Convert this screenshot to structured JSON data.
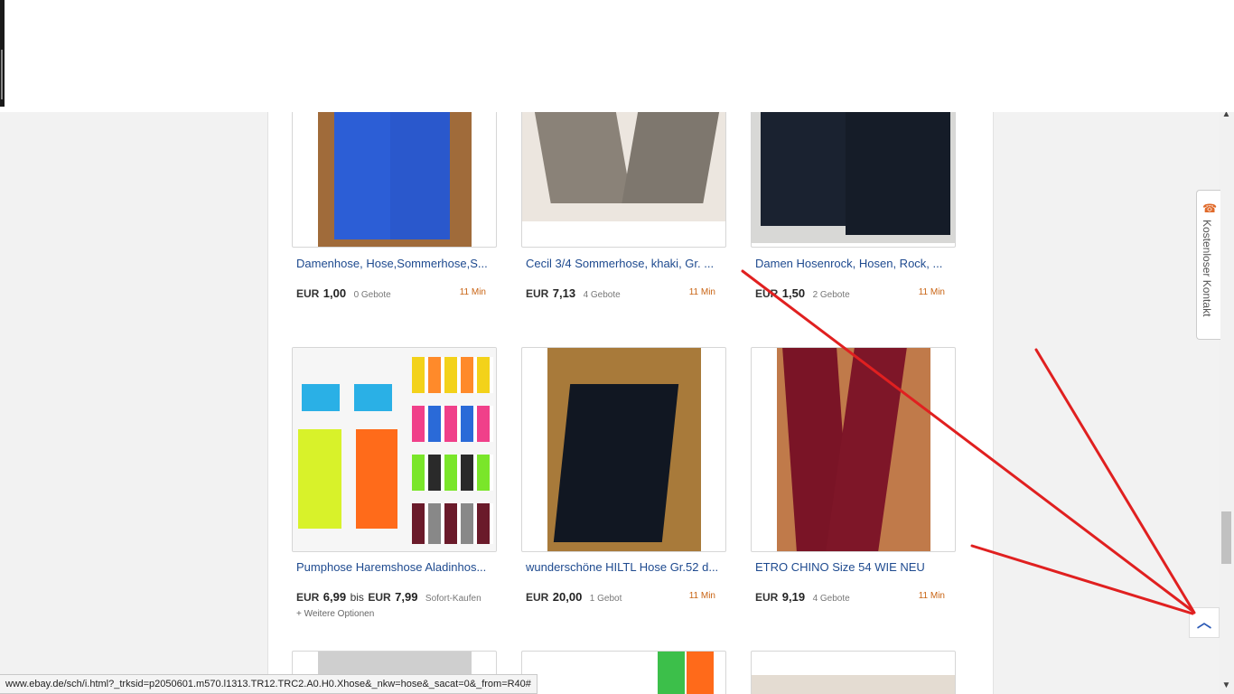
{
  "listings": [
    {
      "title": "Damenhose, Hose,Sommerhose,S...",
      "currency": "EUR",
      "price": "1,00",
      "bids": "0 Gebote",
      "time": "11 Min",
      "image": "blue-pants-photo"
    },
    {
      "title": "Cecil 3/4 Sommerhose, khaki, Gr. ...",
      "currency": "EUR",
      "price": "7,13",
      "bids": "4 Gebote",
      "time": "11 Min",
      "image": "khaki-pants-photo"
    },
    {
      "title": "Damen Hosenrock, Hosen, Rock, ...",
      "currency": "EUR",
      "price": "1,50",
      "bids": "2 Gebote",
      "time": "11 Min",
      "image": "black-culottes-photo"
    },
    {
      "title": "Pumphose Haremshose Aladinhos...",
      "currency": "EUR",
      "price": "6,99",
      "price_connector": "bis",
      "currency2": "EUR",
      "price2": "7,99",
      "bids": "Sofort-Kaufen",
      "more": "+ Weitere Optionen",
      "image": "harem-pants-collage-photo"
    },
    {
      "title": "wunderschöne HILTL Hose Gr.52 d...",
      "currency": "EUR",
      "price": "20,00",
      "bids": "1 Gebot",
      "time": "11 Min",
      "image": "navy-trousers-photo"
    },
    {
      "title": "ETRO CHINO Size 54 WIE NEU",
      "currency": "EUR",
      "price": "9,19",
      "bids": "4 Gebote",
      "time": "11 Min",
      "image": "burgundy-chino-photo"
    }
  ],
  "sidebar": {
    "contact_label": "Kostenloser Kontakt",
    "contact_icon": "phone-icon"
  },
  "back_to_top_icon": "chevron-up-icon",
  "status_url": "www.ebay.de/sch/i.html?_trksid=p2050601.m570.l1313.TR12.TRC2.A0.H0.Xhose&_nkw=hose&_sacat=0&_from=R40#",
  "colors": {
    "link": "#1e4a8f",
    "time": "#c96414",
    "annotation_arrows": "#e02020"
  }
}
